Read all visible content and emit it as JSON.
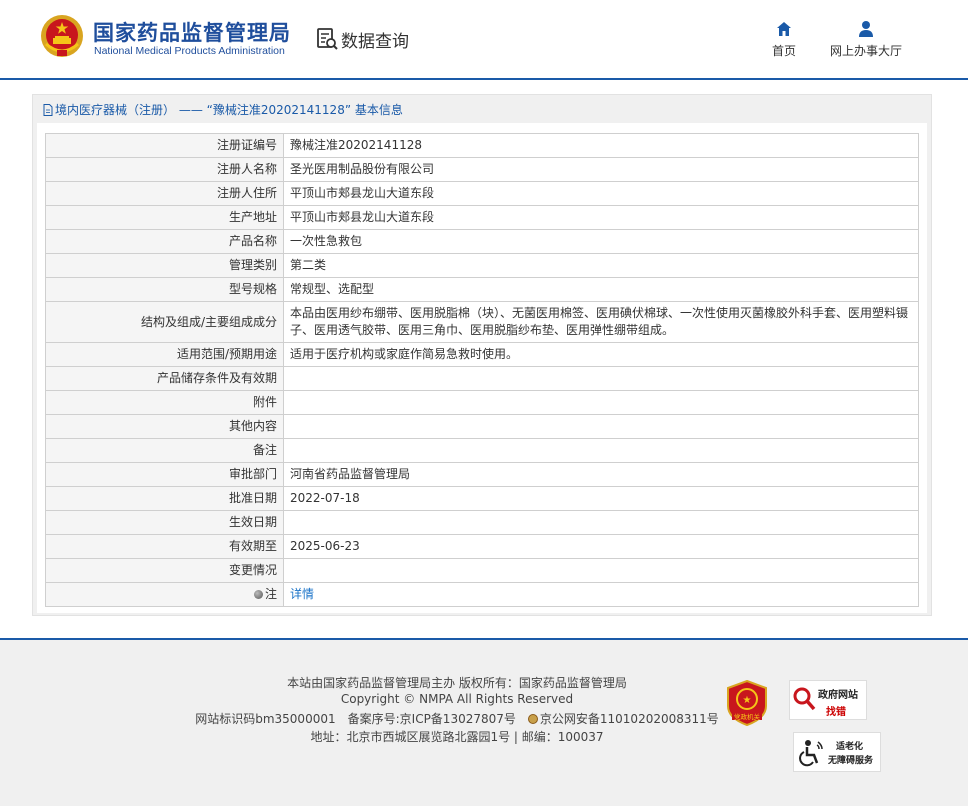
{
  "header": {
    "brand_cn": "国家药品监督管理局",
    "brand_en": "National Medical Products Administration",
    "module_title": "数据查询",
    "nav": [
      {
        "label": "首页",
        "icon": "home-icon"
      },
      {
        "label": "网上办事大厅",
        "icon": "user-icon"
      }
    ]
  },
  "panel": {
    "title": "境内医疗器械（注册） ——  “豫械注准20202141128” 基本信息",
    "rows": [
      {
        "key": "注册证编号",
        "value": "豫械注准20202141128"
      },
      {
        "key": "注册人名称",
        "value": "圣光医用制品股份有限公司"
      },
      {
        "key": "注册人住所",
        "value": "平顶山市郏县龙山大道东段"
      },
      {
        "key": "生产地址",
        "value": "平顶山市郏县龙山大道东段"
      },
      {
        "key": "产品名称",
        "value": "一次性急救包"
      },
      {
        "key": "管理类别",
        "value": "第二类"
      },
      {
        "key": "型号规格",
        "value": "常规型、选配型"
      },
      {
        "key": "结构及组成/主要组成成分",
        "value": "本品由医用纱布绷带、医用脱脂棉（块）、无菌医用棉签、医用碘伏棉球、一次性使用灭菌橡胶外科手套、医用塑料镊子、医用透气胶带、医用三角巾、医用脱脂纱布垫、医用弹性绷带组成。"
      },
      {
        "key": "适用范围/预期用途",
        "value": "适用于医疗机构或家庭作简易急救时使用。"
      },
      {
        "key": "产品储存条件及有效期",
        "value": ""
      },
      {
        "key": "附件",
        "value": ""
      },
      {
        "key": "其他内容",
        "value": ""
      },
      {
        "key": "备注",
        "value": ""
      },
      {
        "key": "审批部门",
        "value": "河南省药品监督管理局"
      },
      {
        "key": "批准日期",
        "value": "2022-07-18"
      },
      {
        "key": "生效日期",
        "value": ""
      },
      {
        "key": "有效期至",
        "value": "2025-06-23"
      },
      {
        "key": "变更情况",
        "value": ""
      }
    ],
    "note_key": "注",
    "note_link": "详情"
  },
  "footer": {
    "line1": "本站由国家药品监督管理局主办 版权所有：国家药品监督管理局",
    "line2": "Copyright © NMPA All Rights Reserved",
    "site_code": "网站标识码bm35000001",
    "icp": "备案序号:京ICP备13027807号",
    "police": "京公网安备11010202008311号",
    "address": "地址：北京市西城区展览路北露园1号 | 邮编：100037",
    "badge_red_text": "党政机关",
    "gov_badge_line1": "政府网站",
    "gov_badge_line2": "找错",
    "acc_badge_line1": "适老化",
    "acc_badge_line2": "无障碍服务"
  },
  "colors": {
    "brand_blue": "#1f4e9c",
    "link_blue": "#1a73c8",
    "accent_red": "#c8161d"
  }
}
